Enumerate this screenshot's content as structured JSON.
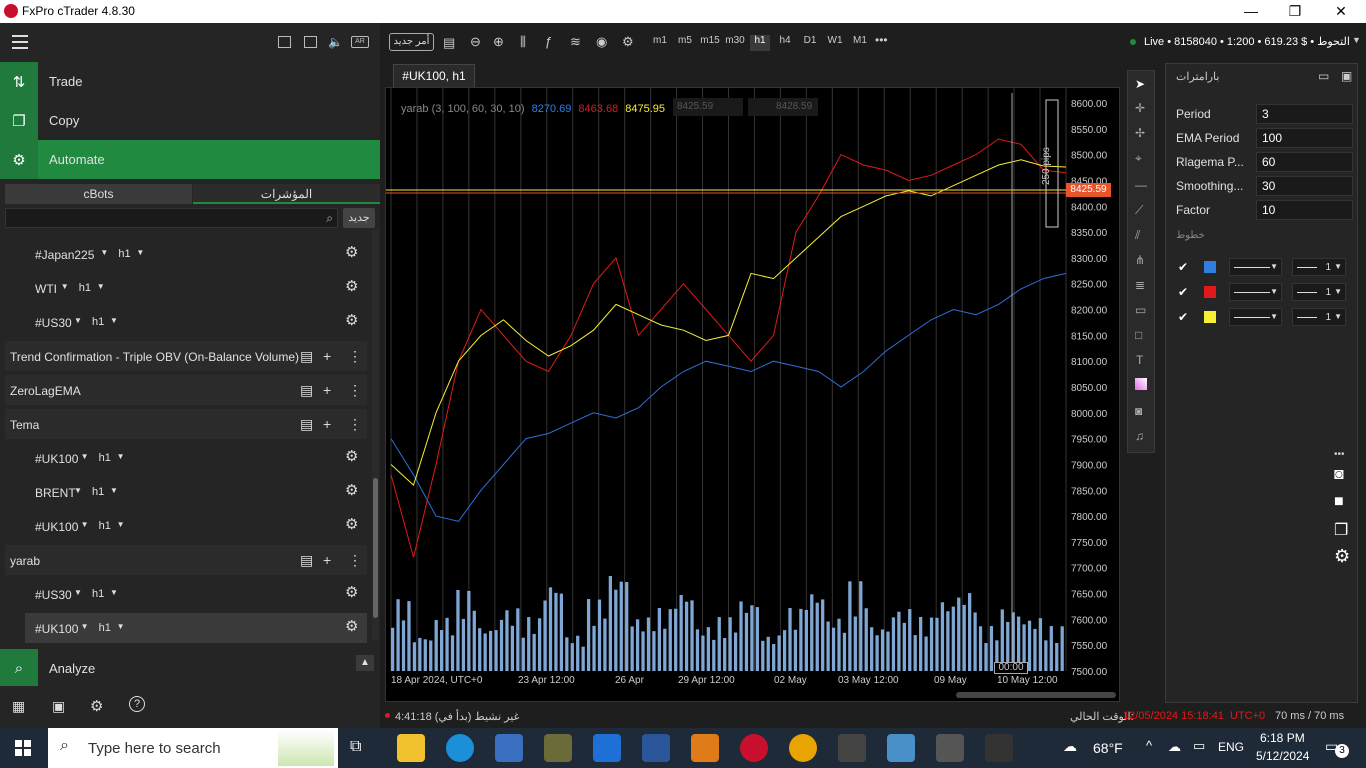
{
  "window": {
    "title": "FxPro cTrader 4.8.30",
    "minimize": "—",
    "maximize": "❐",
    "close": "✕"
  },
  "left_nav": {
    "trade": "Trade",
    "copy": "Copy",
    "automate": "Automate",
    "analyze": "Analyze"
  },
  "automate_tabs": {
    "cbots": "cBots",
    "indicators": "المؤشرات"
  },
  "search": {
    "placeholder": "",
    "new_button": "جديد"
  },
  "list": [
    {
      "type": "instance",
      "symbol": "#Japan225",
      "tf": "h1"
    },
    {
      "type": "instance",
      "symbol": "WTI",
      "tf": "h1"
    },
    {
      "type": "instance",
      "symbol": "#US30",
      "tf": "h1"
    },
    {
      "type": "group",
      "name": "Trend Confirmation - Triple OBV (On-Balance Volume)"
    },
    {
      "type": "group",
      "name": "ZeroLagEMA"
    },
    {
      "type": "group",
      "name": "Tema"
    },
    {
      "type": "instance",
      "symbol": "#UK100",
      "tf": "h1"
    },
    {
      "type": "instance",
      "symbol": "BRENT",
      "tf": "h1"
    },
    {
      "type": "instance",
      "symbol": "#UK100",
      "tf": "h1"
    },
    {
      "type": "group",
      "name": "yarab"
    },
    {
      "type": "instance",
      "symbol": "#US30",
      "tf": "h1"
    },
    {
      "type": "instance",
      "symbol": "#UK100",
      "tf": "h1",
      "selected": true
    }
  ],
  "toolbar": {
    "new_order": "أمر جديد",
    "timeframes": [
      "m1",
      "m5",
      "m15",
      "m30",
      "h1",
      "h4",
      "D1",
      "W1",
      "M1"
    ],
    "active_tf": "h1",
    "more": "•••",
    "account": "Live • 8158040 • 1:200 • 619.23 $ • التحوط"
  },
  "chart_tab": "#UK100, h1",
  "chart_info": {
    "indicator": "yarab (3, 100, 60, 30, 10)",
    "v1": "8270.69",
    "v2": "8463.68",
    "v3": "8475.95",
    "sell": "8425.59",
    "buy": "8428.59",
    "current_price": "8425.59",
    "pips": "250 pips",
    "cursor_time": "00:00"
  },
  "chart_data": {
    "type": "line",
    "ylim": [
      7500,
      8600
    ],
    "y_ticks": [
      "8600.00",
      "8550.00",
      "8500.00",
      "8450.00",
      "8400.00",
      "8350.00",
      "8300.00",
      "8250.00",
      "8200.00",
      "8150.00",
      "8100.00",
      "8050.00",
      "8000.00",
      "7950.00",
      "7900.00",
      "7850.00",
      "7800.00",
      "7750.00",
      "7700.00",
      "7650.00",
      "7600.00",
      "7550.00",
      "7500.00"
    ],
    "x_ticks": [
      "18 Apr 2024, UTC+0",
      "23 Apr 12:00",
      "26 Apr",
      "29 Apr 12:00",
      "02 May",
      "03 May 12:00",
      "09 May",
      "10 May 12:00"
    ],
    "series": [
      {
        "name": "yarab",
        "color": "#2f6fd6",
        "values": [
          7950,
          7880,
          7800,
          7790,
          7850,
          7900,
          7950,
          7960,
          7980,
          8000,
          7990,
          8010,
          8050,
          8080,
          8100,
          8090,
          8080,
          8100,
          8090,
          8080,
          8050,
          8080,
          8120,
          8150,
          8180,
          8200,
          8190,
          8210,
          8240,
          8260,
          8270
        ]
      },
      {
        "name": "",
        "color": "#e01a1a",
        "values": [
          7880,
          7720,
          7900,
          8100,
          8200,
          8150,
          8100,
          8080,
          8150,
          8250,
          8300,
          8150,
          8200,
          8250,
          8200,
          8150,
          8100,
          8150,
          8350,
          8420,
          8500,
          8480,
          8470,
          8450,
          8460,
          8480,
          8500,
          8530,
          8520,
          8470,
          8465
        ]
      },
      {
        "name": "",
        "color": "#f5f033",
        "values": [
          7900,
          7860,
          8000,
          8100,
          8150,
          8180,
          8140,
          8110,
          8130,
          8160,
          8210,
          8190,
          8170,
          8160,
          8140,
          8150,
          8270,
          8260,
          8300,
          8340,
          8380,
          8400,
          8420,
          8430,
          8420,
          8440,
          8460,
          8480,
          8490,
          8478,
          8476
        ]
      }
    ],
    "volume": [
      80,
      40,
      60,
      90,
      50,
      70,
      60,
      100,
      40,
      80,
      110,
      60,
      70,
      90,
      50,
      60,
      80,
      40,
      70,
      90,
      60,
      100,
      50,
      70,
      60,
      80,
      90,
      50,
      70,
      60,
      50
    ]
  },
  "params": {
    "title": "بارامترات",
    "rows": [
      {
        "label": "Period",
        "value": "3"
      },
      {
        "label": "EMA Period",
        "value": "100"
      },
      {
        "label": "Rlagema P...",
        "value": "60"
      },
      {
        "label": "Smoothing...",
        "value": "30"
      },
      {
        "label": "Factor",
        "value": "10"
      }
    ],
    "lines_label": "خطوط",
    "line_colors": [
      "#2f7fe0",
      "#e01a1a",
      "#f5f033"
    ],
    "line_widths": [
      "1",
      "1",
      "1"
    ]
  },
  "status": {
    "left": "4:41:18 (غير نشيط (بدأ في",
    "current_time_label": "الوقت الحالي:",
    "current_time": "12/05/2024 15:18:41",
    "tz": "UTC+0",
    "latency": "70 ms / 70 ms"
  },
  "taskbar": {
    "search_placeholder": "Type here to search",
    "weather": "68°F",
    "lang": "ENG",
    "time": "6:18 PM",
    "date": "5/12/2024",
    "notifications": "3"
  }
}
